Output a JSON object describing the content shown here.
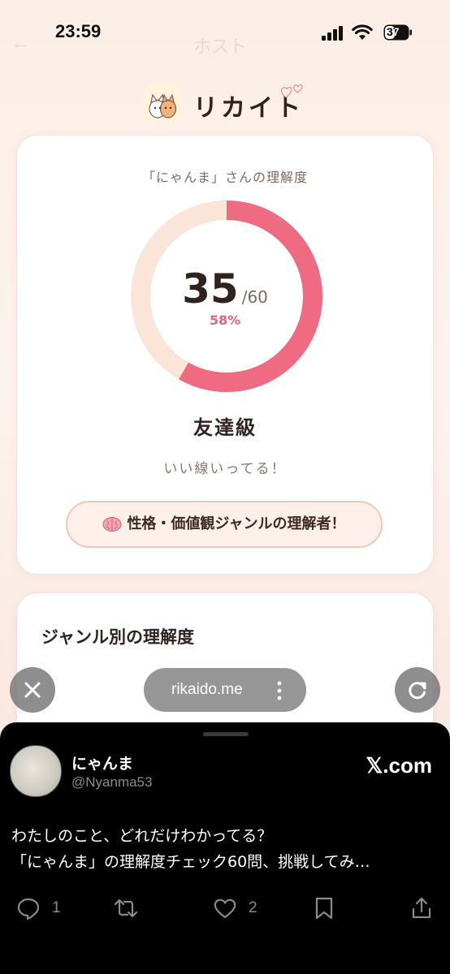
{
  "status_bar": {
    "time": "23:59",
    "battery": "37"
  },
  "ghost": {
    "back": "←",
    "title": "ホスト"
  },
  "app": {
    "name": "リカイト"
  },
  "result": {
    "title": "「にゃんま」さんの理解度",
    "score": "35",
    "total": "/60",
    "percent_label": "58%",
    "progress_fraction": 0.583,
    "rank": "友達級",
    "comment": "いい線いってる！",
    "badge": "性格・価値観ジャンルの理解者！",
    "accent_color": "#ee6b81",
    "track_color": "#fbe4d8"
  },
  "genre": {
    "title": "ジャンル別の理解度"
  },
  "browser": {
    "url": "rikaido.me"
  },
  "tweet_sheet": {
    "author": "にゃんま",
    "handle": "@Nyanma53",
    "source": "𝕏.com",
    "text_line1": "わたしのこと、どれだけわかってる？",
    "text_line2": "「にゃんま」の理解度チェック60問、挑戦してみ…",
    "replies": "1",
    "likes": "2"
  }
}
